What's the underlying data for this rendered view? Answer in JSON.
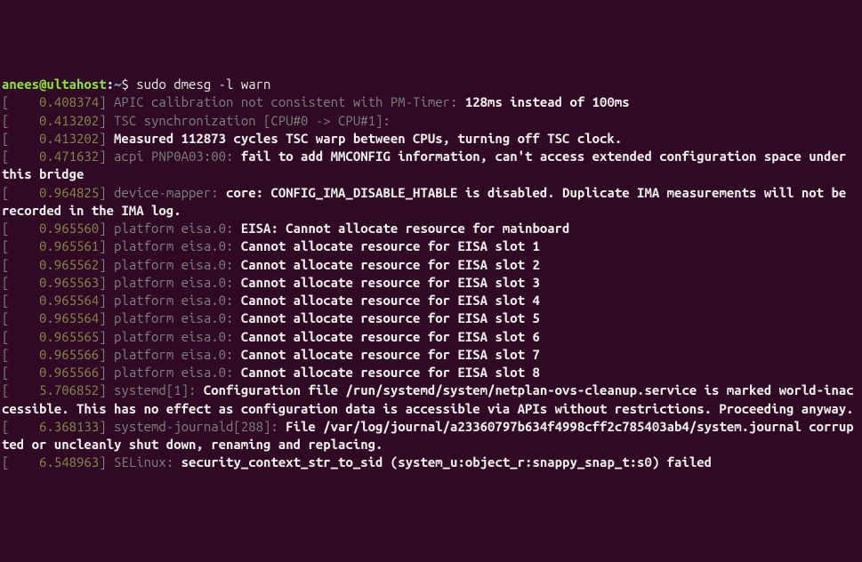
{
  "prompt": {
    "user": "anees",
    "host": "ultahost",
    "path": "~",
    "symbol": "$",
    "command": "sudo dmesg -l warn"
  },
  "lines": [
    {
      "ts": "0.408374",
      "prefix": "APIC calibration not consistent with PM-Timer: ",
      "msg": "128ms instead of 100ms"
    },
    {
      "ts": "0.413202",
      "prefix": "TSC synchronization [CPU#0 -> CPU#1]:",
      "msg": ""
    },
    {
      "ts": "0.413202",
      "prefix": "",
      "msg": "Measured 112873 cycles TSC warp between CPUs, turning off TSC clock."
    },
    {
      "ts": "0.471632",
      "prefix": "acpi PNP0A03:00: ",
      "msg": "fail to add MMCONFIG information, can't access extended configuration space under this bridge"
    },
    {
      "ts": "0.964825",
      "prefix": "device-mapper: ",
      "msg": "core: CONFIG_IMA_DISABLE_HTABLE is disabled. Duplicate IMA measurements will not be recorded in the IMA log."
    },
    {
      "ts": "0.965560",
      "prefix": "platform eisa.0: ",
      "msg": "EISA: Cannot allocate resource for mainboard"
    },
    {
      "ts": "0.965561",
      "prefix": "platform eisa.0: ",
      "msg": "Cannot allocate resource for EISA slot 1"
    },
    {
      "ts": "0.965562",
      "prefix": "platform eisa.0: ",
      "msg": "Cannot allocate resource for EISA slot 2"
    },
    {
      "ts": "0.965563",
      "prefix": "platform eisa.0: ",
      "msg": "Cannot allocate resource for EISA slot 3"
    },
    {
      "ts": "0.965564",
      "prefix": "platform eisa.0: ",
      "msg": "Cannot allocate resource for EISA slot 4"
    },
    {
      "ts": "0.965564",
      "prefix": "platform eisa.0: ",
      "msg": "Cannot allocate resource for EISA slot 5"
    },
    {
      "ts": "0.965565",
      "prefix": "platform eisa.0: ",
      "msg": "Cannot allocate resource for EISA slot 6"
    },
    {
      "ts": "0.965566",
      "prefix": "platform eisa.0: ",
      "msg": "Cannot allocate resource for EISA slot 7"
    },
    {
      "ts": "0.965566",
      "prefix": "platform eisa.0: ",
      "msg": "Cannot allocate resource for EISA slot 8"
    },
    {
      "ts": "5.706852",
      "prefix": "systemd[1]: ",
      "msg": "Configuration file /run/systemd/system/netplan-ovs-cleanup.service is marked world-inaccessible. This has no effect as configuration data is accessible via APIs without restrictions. Proceeding anyway."
    },
    {
      "ts": "6.368133",
      "prefix": "systemd-journald[288]: ",
      "msg": "File /var/log/journal/a23360797b634f4998cff2c785403ab4/system.journal corrupted or uncleanly shut down, renaming and replacing."
    },
    {
      "ts": "6.548963",
      "prefix": "SELinux: ",
      "msg": "security_context_str_to_sid (system_u:object_r:snappy_snap_t:s0) failed"
    }
  ]
}
